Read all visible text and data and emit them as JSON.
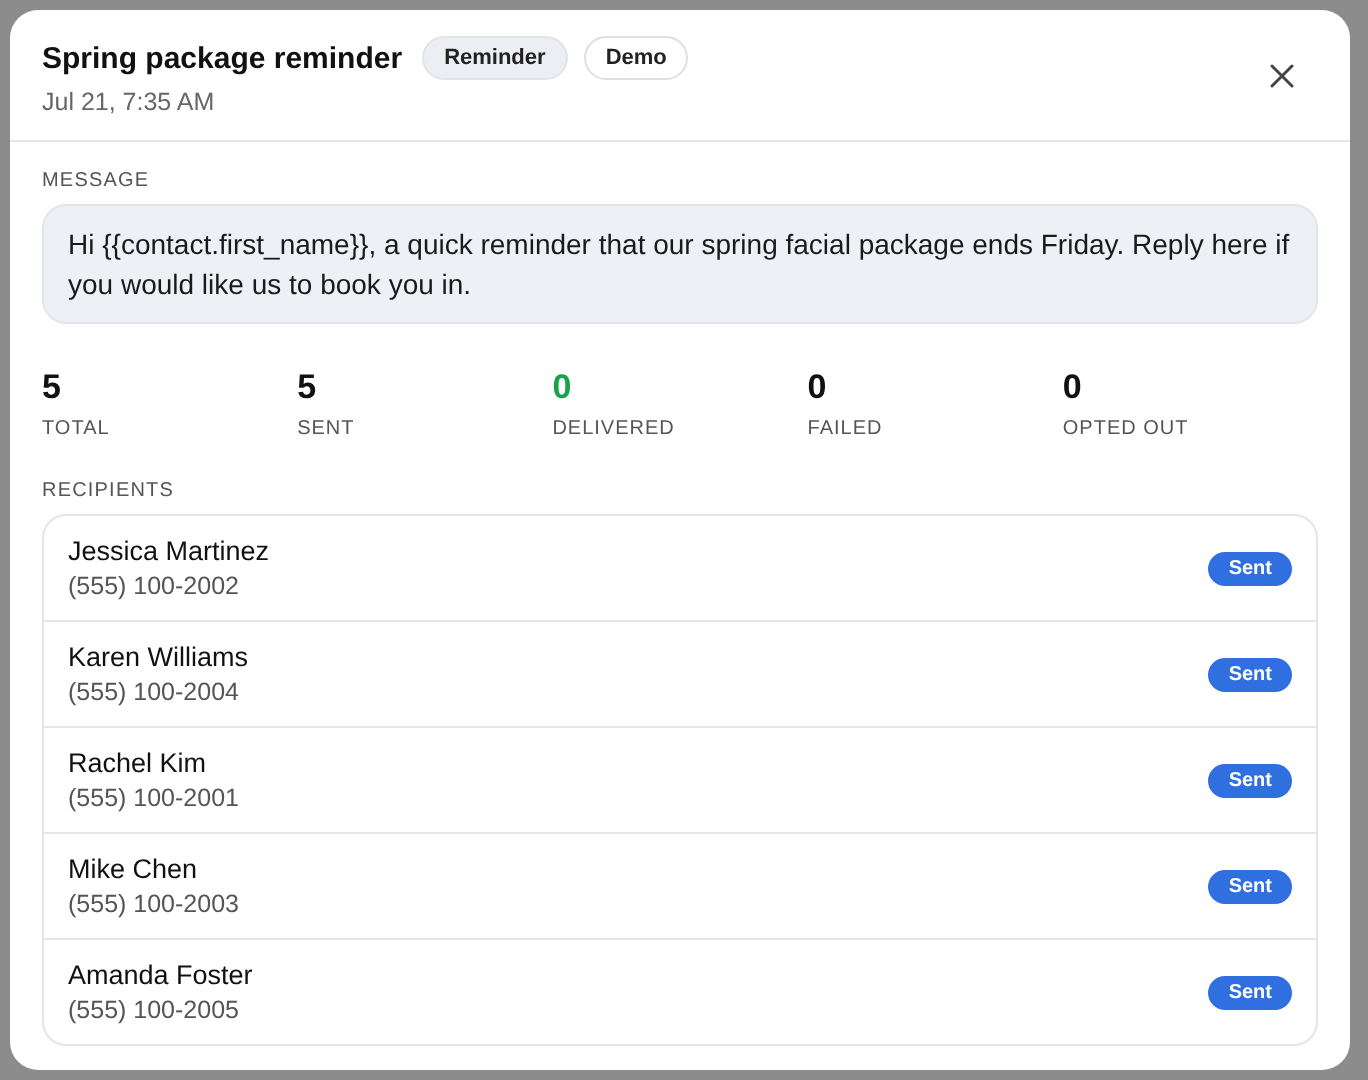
{
  "modal": {
    "title": "Spring package reminder",
    "tags": [
      {
        "label": "Reminder",
        "kind": "filled"
      },
      {
        "label": "Demo",
        "kind": "outline"
      }
    ],
    "timestamp": "Jul 21, 7:35 AM"
  },
  "message": {
    "label": "MESSAGE",
    "text": "Hi {{contact.first_name}}, a quick reminder that our spring facial package ends Friday. Reply here if you would like us to book you in."
  },
  "stats": [
    {
      "value": "5",
      "label": "TOTAL",
      "color": "#111111"
    },
    {
      "value": "5",
      "label": "SENT",
      "color": "#111111"
    },
    {
      "value": "0",
      "label": "DELIVERED",
      "color": "#16a34a"
    },
    {
      "value": "0",
      "label": "FAILED",
      "color": "#111111"
    },
    {
      "value": "0",
      "label": "OPTED OUT",
      "color": "#111111"
    }
  ],
  "recipients": {
    "label": "RECIPIENTS",
    "items": [
      {
        "name": "Jessica Martinez",
        "phone": "(555) 100-2002",
        "status": "Sent"
      },
      {
        "name": "Karen Williams",
        "phone": "(555) 100-2004",
        "status": "Sent"
      },
      {
        "name": "Rachel Kim",
        "phone": "(555) 100-2001",
        "status": "Sent"
      },
      {
        "name": "Mike Chen",
        "phone": "(555) 100-2003",
        "status": "Sent"
      },
      {
        "name": "Amanda Foster",
        "phone": "(555) 100-2005",
        "status": "Sent"
      }
    ]
  }
}
